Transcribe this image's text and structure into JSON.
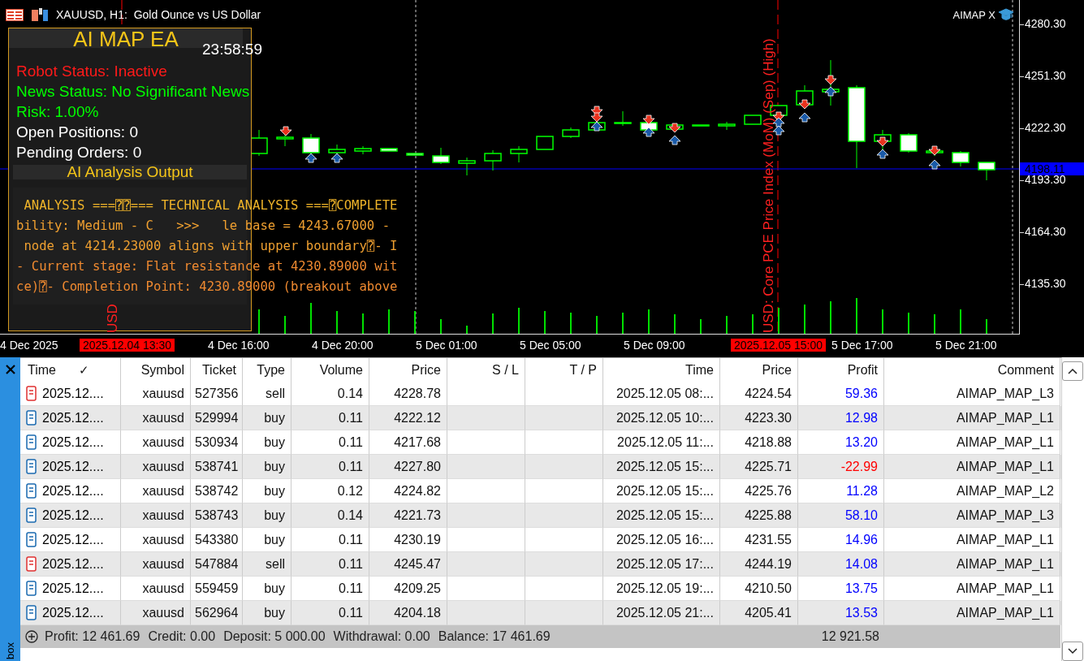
{
  "chart": {
    "title": "XAUUSD, H1:  Gold Ounce vs US Dollar",
    "badge": "AIMAP X",
    "price_labels": [
      "4280.30",
      "4251.30",
      "4222.30",
      "4193.30",
      "4164.30",
      "4135.30"
    ],
    "current_price": "4198.11",
    "time_labels": [
      {
        "text": "4 Dec 2025",
        "highlight": false
      },
      {
        "text": "2025.12.04 13:30",
        "highlight": true
      },
      {
        "text": "4 Dec 16:00",
        "highlight": false
      },
      {
        "text": "4 Dec 20:00",
        "highlight": false
      },
      {
        "text": "5 Dec 01:00",
        "highlight": false
      },
      {
        "text": "5 Dec 05:00",
        "highlight": false
      },
      {
        "text": "5 Dec 09:00",
        "highlight": false
      },
      {
        "text": "2025.12.05 15:00",
        "highlight": true
      },
      {
        "text": "5 Dec 17:00",
        "highlight": false
      },
      {
        "text": "5 Dec 21:00",
        "highlight": false
      }
    ],
    "event_labels": [
      "USD",
      "USD: Core PCE Price Index (MoM) (Sep) (High)"
    ]
  },
  "ea_panel": {
    "title": "AI MAP EA",
    "clock": "23:58:59",
    "status_lines": [
      {
        "text": "Robot Status: Inactive",
        "color": "#ff1a1a"
      },
      {
        "text": "News Status: No Significant News",
        "color": "#00ff00"
      },
      {
        "text": "Risk: 1.00%",
        "color": "#00ff00"
      },
      {
        "text": "Open Positions: 0",
        "color": "#ffffff"
      },
      {
        "text": "Pending Orders: 0",
        "color": "#ffffff"
      }
    ],
    "section_title": "AI Analysis Output",
    "analysis_lines": [
      {
        "text": " ANALYSIS ===⍰⍰=== TECHNICAL ANALYSIS ===⍰COMPLETE",
        "color": "#f0b429"
      },
      {
        "text": "bility: Medium - C   >>>   le base = 4243.67000 -",
        "color": "#f0a030"
      },
      {
        "text": " node at 4214.23000 aligns with upper boundary⍰- I",
        "color": "#f0a030"
      },
      {
        "text": "- Current stage: Flat resistance at 4230.89000 wit",
        "color": "#f08a30"
      },
      {
        "text": "ce)⍰- Completion Point: 4230.89000 (breakout above",
        "color": "#f08a30"
      }
    ]
  },
  "table": {
    "columns": [
      {
        "label": "Time",
        "sort_mark": "✓"
      },
      {
        "label": "Symbol"
      },
      {
        "label": "Ticket"
      },
      {
        "label": "Type"
      },
      {
        "label": "Volume"
      },
      {
        "label": "Price"
      },
      {
        "label": "S / L"
      },
      {
        "label": "T / P"
      },
      {
        "label": "Time"
      },
      {
        "label": "Price"
      },
      {
        "label": "Profit"
      },
      {
        "label": "Comment"
      }
    ],
    "rows": [
      {
        "kind": "sell",
        "time": "2025.12....",
        "symbol": "xauusd",
        "ticket": "527356",
        "type": "sell",
        "volume": "0.14",
        "price": "4228.78",
        "close_time": "2025.12.05 08:...",
        "close_price": "4224.54",
        "profit": "59.36",
        "color": "#0000ff",
        "comment": "AIMAP_MAP_L3"
      },
      {
        "kind": "buy",
        "time": "2025.12....",
        "symbol": "xauusd",
        "ticket": "529994",
        "type": "buy",
        "volume": "0.11",
        "price": "4222.12",
        "close_time": "2025.12.05 10:...",
        "close_price": "4223.30",
        "profit": "12.98",
        "color": "#0000ff",
        "comment": "AIMAP_MAP_L1"
      },
      {
        "kind": "buy",
        "time": "2025.12....",
        "symbol": "xauusd",
        "ticket": "530934",
        "type": "buy",
        "volume": "0.11",
        "price": "4217.68",
        "close_time": "2025.12.05 11:...",
        "close_price": "4218.88",
        "profit": "13.20",
        "color": "#0000ff",
        "comment": "AIMAP_MAP_L1"
      },
      {
        "kind": "buy",
        "time": "2025.12....",
        "symbol": "xauusd",
        "ticket": "538741",
        "type": "buy",
        "volume": "0.11",
        "price": "4227.80",
        "close_time": "2025.12.05 15:...",
        "close_price": "4225.71",
        "profit": "-22.99",
        "color": "#ff0000",
        "comment": "AIMAP_MAP_L1"
      },
      {
        "kind": "buy",
        "time": "2025.12....",
        "symbol": "xauusd",
        "ticket": "538742",
        "type": "buy",
        "volume": "0.12",
        "price": "4224.82",
        "close_time": "2025.12.05 15:...",
        "close_price": "4225.76",
        "profit": "11.28",
        "color": "#0000ff",
        "comment": "AIMAP_MAP_L2"
      },
      {
        "kind": "buy",
        "time": "2025.12....",
        "symbol": "xauusd",
        "ticket": "538743",
        "type": "buy",
        "volume": "0.14",
        "price": "4221.73",
        "close_time": "2025.12.05 15:...",
        "close_price": "4225.88",
        "profit": "58.10",
        "color": "#0000ff",
        "comment": "AIMAP_MAP_L3"
      },
      {
        "kind": "buy",
        "time": "2025.12....",
        "symbol": "xauusd",
        "ticket": "543380",
        "type": "buy",
        "volume": "0.11",
        "price": "4230.19",
        "close_time": "2025.12.05 16:...",
        "close_price": "4231.55",
        "profit": "14.96",
        "color": "#0000ff",
        "comment": "AIMAP_MAP_L1"
      },
      {
        "kind": "sell",
        "time": "2025.12....",
        "symbol": "xauusd",
        "ticket": "547884",
        "type": "sell",
        "volume": "0.11",
        "price": "4245.47",
        "close_time": "2025.12.05 17:...",
        "close_price": "4244.19",
        "profit": "14.08",
        "color": "#0000ff",
        "comment": "AIMAP_MAP_L1"
      },
      {
        "kind": "buy",
        "time": "2025.12....",
        "symbol": "xauusd",
        "ticket": "559459",
        "type": "buy",
        "volume": "0.11",
        "price": "4209.25",
        "close_time": "2025.12.05 19:...",
        "close_price": "4210.50",
        "profit": "13.75",
        "color": "#0000ff",
        "comment": "AIMAP_MAP_L1"
      },
      {
        "kind": "buy",
        "time": "2025.12....",
        "symbol": "xauusd",
        "ticket": "562964",
        "type": "buy",
        "volume": "0.11",
        "price": "4204.18",
        "close_time": "2025.12.05 21:...",
        "close_price": "4205.41",
        "profit": "13.53",
        "color": "#0000ff",
        "comment": "AIMAP_MAP_L1"
      }
    ],
    "summary": {
      "items": [
        "Profit: 12 461.69",
        "Credit: 0.00",
        "Deposit: 5 000.00",
        "Withdrawal: 0.00",
        "Balance: 17 461.69"
      ],
      "total": "12 921.58"
    }
  },
  "side_tab": {
    "label": "box"
  }
}
